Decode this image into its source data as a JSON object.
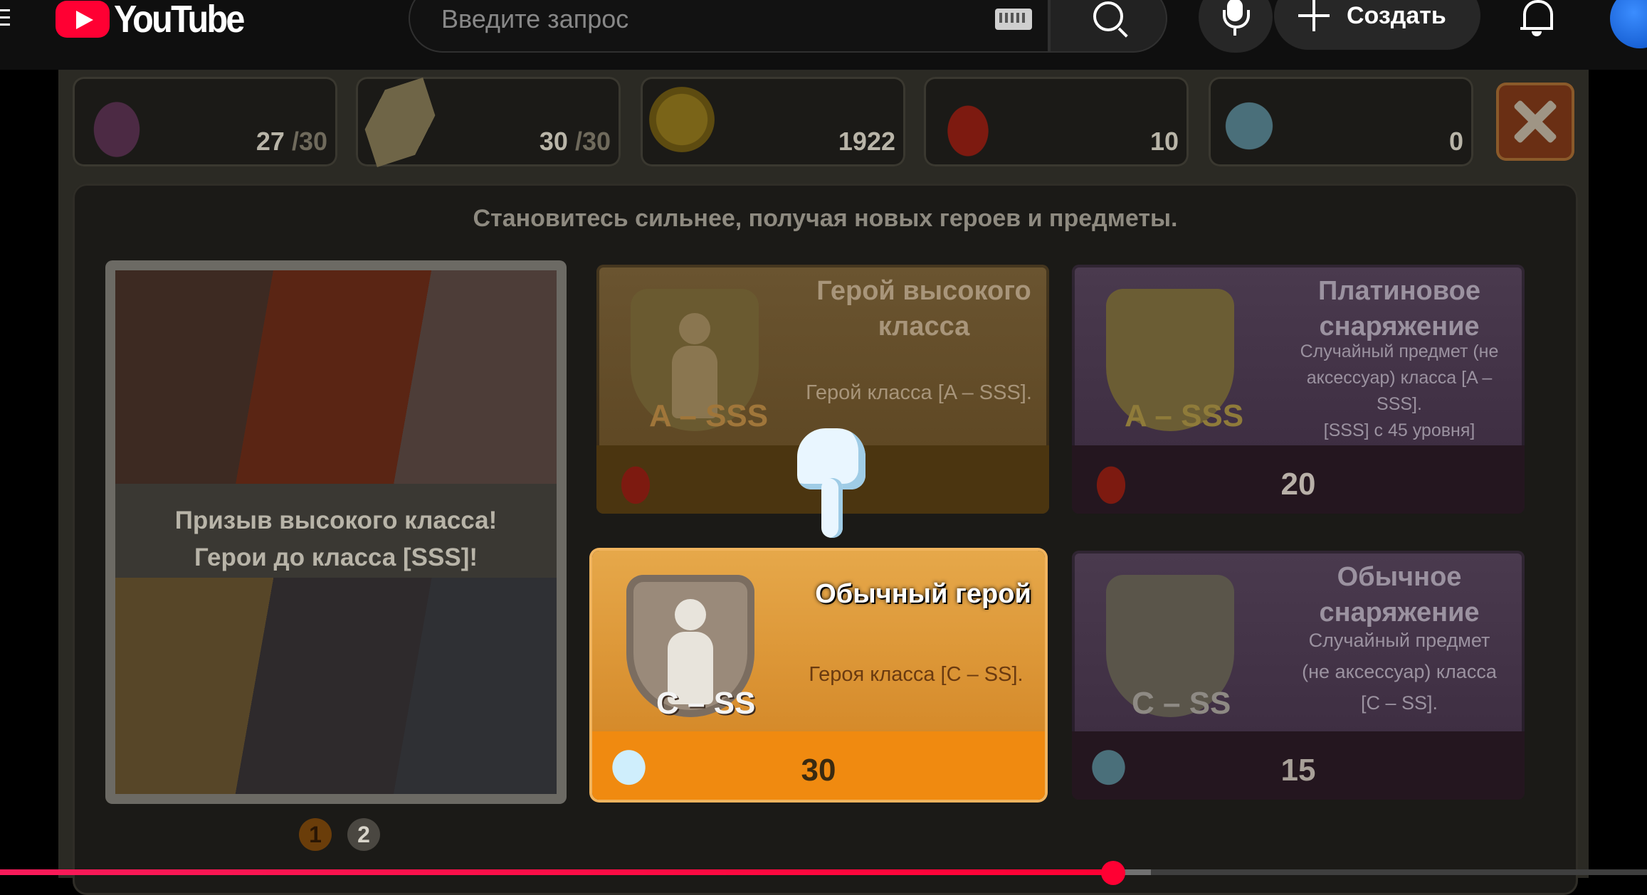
{
  "youtube": {
    "logo_text": "YouTube",
    "search_placeholder": "Введите запрос",
    "create_label": "Создать"
  },
  "game": {
    "resources": [
      {
        "icon": "boot-icon",
        "value": "27",
        "max": "/30"
      },
      {
        "icon": "ticket-icon",
        "value": "30",
        "max": "/30"
      },
      {
        "icon": "gold-coin-icon",
        "value": "1922",
        "max": ""
      },
      {
        "icon": "ruby-drop-icon",
        "value": "10",
        "max": ""
      },
      {
        "icon": "thumbs-up-icon",
        "value": "0",
        "max": ""
      }
    ],
    "subtitle": "Становитесь сильнее, получая новых героев и предметы.",
    "promo": {
      "line1": "Призыв высокого класса!",
      "line2": "Герои до класса [SSS]!"
    },
    "cards": {
      "hero_high": {
        "title_line1": "Герой высокого",
        "title_line2": "класса",
        "desc": "Герой класса [A – SSS].",
        "grade": "A – SSS"
      },
      "platinum_equipment": {
        "title_line1": "Платиновое",
        "title_line2": "снаряжение",
        "desc_line1": "Случайный предмет (не",
        "desc_line2": "аксессуар) класса [A –",
        "desc_line3": "SSS].",
        "desc_line4": "[SSS] с 45 уровня]",
        "grade": "A – SSS",
        "price": "20"
      },
      "hero_common": {
        "title": "Обычный герой",
        "desc": "Героя класса [C – SS].",
        "grade": "C – SS",
        "price": "30"
      },
      "common_equipment": {
        "title_line1": "Обычное",
        "title_line2": "снаряжение",
        "desc_line1": "Случайный предмет",
        "desc_line2": "(не аксессуар) класса",
        "desc_line3": "[C – SS].",
        "grade": "C – SS",
        "price": "15"
      }
    },
    "pages": [
      "1",
      "2"
    ],
    "current_page": 1
  },
  "player": {
    "played_fraction": 0.676,
    "buffered_fraction": 0.699
  },
  "colors": {
    "youtube_red": "#ff0033",
    "common_card_orange": "#f08a10"
  }
}
